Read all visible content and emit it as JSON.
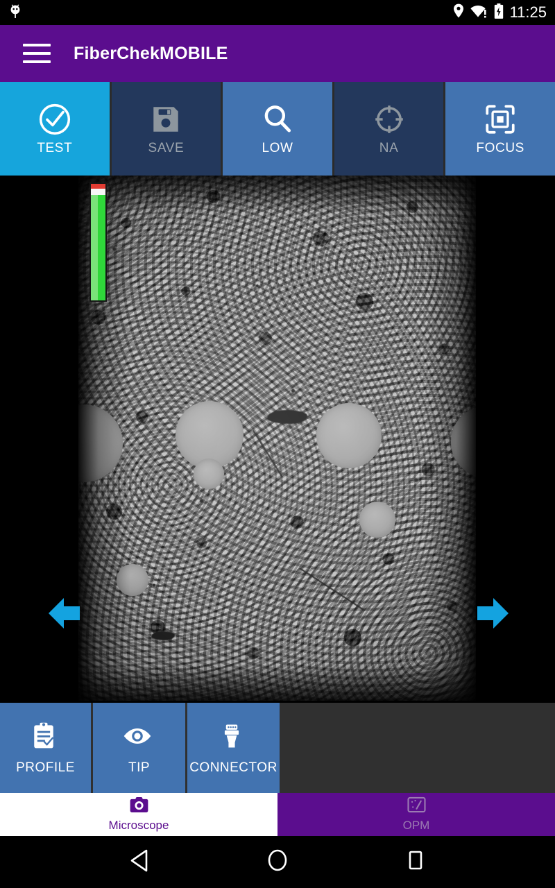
{
  "status_bar": {
    "time": "11:25",
    "icons": [
      "android-bug-icon",
      "location-pin-icon",
      "wifi-alert-icon",
      "battery-charging-icon"
    ]
  },
  "app_bar": {
    "menu_icon": "hamburger-menu-icon",
    "title": "FiberChekMOBILE",
    "background_color": "#5b0d8e"
  },
  "toolbar": {
    "buttons": [
      {
        "label": "TEST",
        "icon": "check-circle-icon",
        "state": "active",
        "color": "#16a5dc"
      },
      {
        "label": "SAVE",
        "icon": "floppy-disk-icon",
        "state": "disabled",
        "color": "#23385c"
      },
      {
        "label": "LOW",
        "icon": "magnifier-icon",
        "state": "normal",
        "color": "#4273b0"
      },
      {
        "label": "NA",
        "icon": "crosshair-icon",
        "state": "disabled",
        "color": "#23385c"
      },
      {
        "label": "FOCUS",
        "icon": "focus-frame-icon",
        "state": "normal",
        "color": "#4273b0"
      }
    ]
  },
  "viewer": {
    "name": "microscope-live-view",
    "focus_gauge": {
      "name": "focus-quality-gauge",
      "red_zone_percent": 4,
      "green_fill_percent": 91,
      "red_color": "#e23b32",
      "green_color": "#2fd83a"
    },
    "nav_prev_icon": "arrow-left-icon",
    "nav_next_icon": "arrow-right-icon",
    "arrow_color": "#14a3e0"
  },
  "action_bar": {
    "buttons": [
      {
        "label": "PROFILE",
        "icon": "clipboard-check-icon"
      },
      {
        "label": "TIP",
        "icon": "eye-icon"
      },
      {
        "label": "CONNECTOR",
        "icon": "connector-plug-icon"
      }
    ],
    "button_color": "#4273b0",
    "background_color": "#303030"
  },
  "tab_bar": {
    "tabs": [
      {
        "label": "Microscope",
        "icon": "camera-icon",
        "active": true
      },
      {
        "label": "OPM",
        "icon": "power-meter-icon",
        "active": false
      }
    ],
    "active_text_color": "#5b0d8e"
  },
  "nav_bar": {
    "buttons": [
      {
        "name": "back-button",
        "icon": "triangle-back-icon"
      },
      {
        "name": "home-button",
        "icon": "circle-home-icon"
      },
      {
        "name": "recents-button",
        "icon": "square-recents-icon"
      }
    ]
  }
}
